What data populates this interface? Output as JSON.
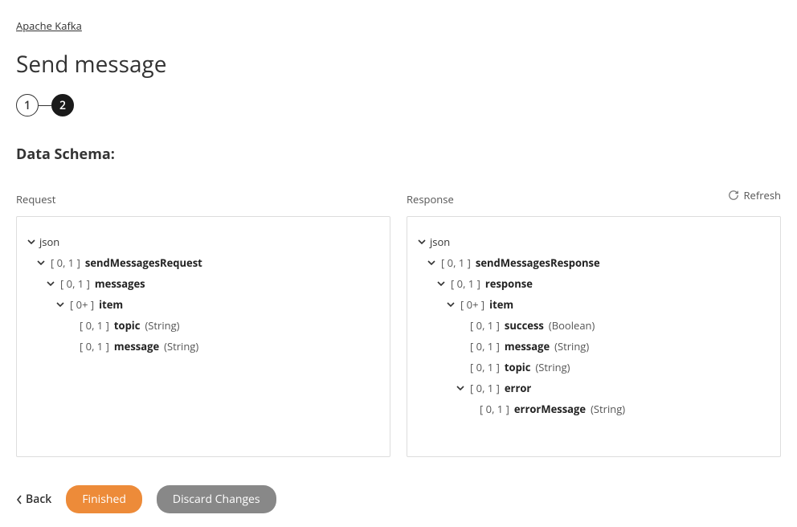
{
  "breadcrumb": "Apache Kafka",
  "page_title": "Send message",
  "steps": {
    "s1": "1",
    "s2": "2"
  },
  "section_title": "Data Schema:",
  "refresh_label": "Refresh",
  "request_label": "Request",
  "response_label": "Response",
  "req": {
    "root": "json",
    "n1_card": "[ 0, 1 ]",
    "n1_name": "sendMessagesRequest",
    "n2_card": "[ 0, 1 ]",
    "n2_name": "messages",
    "n3_card": "[ 0+ ]",
    "n3_name": "item",
    "n4_card": "[ 0, 1 ]",
    "n4_name": "topic",
    "n4_type": "(String)",
    "n5_card": "[ 0, 1 ]",
    "n5_name": "message",
    "n5_type": "(String)"
  },
  "res": {
    "root": "json",
    "n1_card": "[ 0, 1 ]",
    "n1_name": "sendMessagesResponse",
    "n2_card": "[ 0, 1 ]",
    "n2_name": "response",
    "n3_card": "[ 0+ ]",
    "n3_name": "item",
    "n4_card": "[ 0, 1 ]",
    "n4_name": "success",
    "n4_type": "(Boolean)",
    "n5_card": "[ 0, 1 ]",
    "n5_name": "message",
    "n5_type": "(String)",
    "n6_card": "[ 0, 1 ]",
    "n6_name": "topic",
    "n6_type": "(String)",
    "n7_card": "[ 0, 1 ]",
    "n7_name": "error",
    "n8_card": "[ 0, 1 ]",
    "n8_name": "errorMessage",
    "n8_type": "(String)"
  },
  "footer": {
    "back": "Back",
    "finished": "Finished",
    "discard": "Discard Changes"
  }
}
